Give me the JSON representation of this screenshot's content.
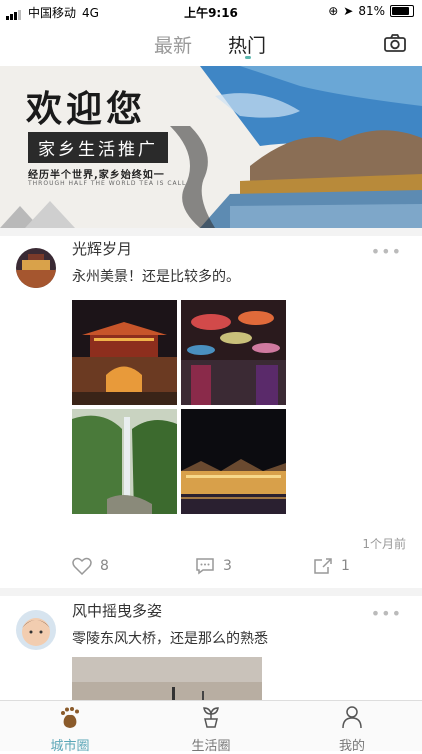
{
  "status": {
    "carrier": "中国移动",
    "network": "4G",
    "time": "上午9:16",
    "battery": "81%"
  },
  "nav": {
    "tabs": [
      "最新",
      "热门"
    ],
    "active_tab": "热门",
    "camera_icon": "camera-icon"
  },
  "banner": {
    "title": "欢迎您",
    "tag": "家乡生活推广",
    "subtitle": "经历半个世界,家乡始终如一",
    "english": "THROUGH HALF THE WORLD TEA IS CALL"
  },
  "posts": [
    {
      "author": "光辉岁月",
      "text": "永州美景！还是比较多的。",
      "time": "1个月前",
      "likes": "8",
      "comments": "3",
      "shares": "1"
    },
    {
      "author": "风中摇曳多姿",
      "text": "零陵东风大桥，还是那么的熟悉"
    }
  ],
  "bottom_nav": [
    {
      "label": "城市圈",
      "icon": "footprint-icon",
      "active": true
    },
    {
      "label": "生活圈",
      "icon": "sprout-icon",
      "active": false
    },
    {
      "label": "我的",
      "icon": "person-icon",
      "active": false
    }
  ],
  "colors": {
    "accent": "#5aa6b7",
    "tab_dot": "#5bb6ad"
  }
}
